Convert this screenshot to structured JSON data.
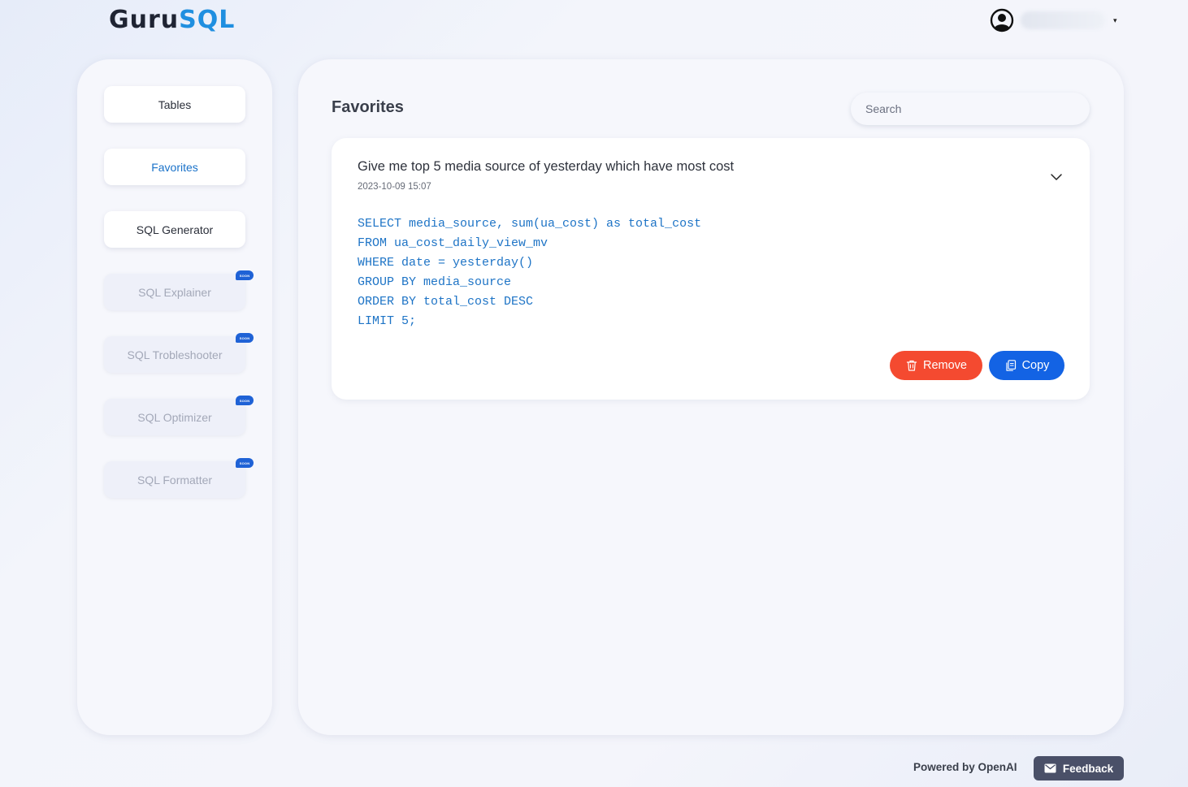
{
  "brand": {
    "logo_part1": "Guru",
    "logo_part2": "SQL"
  },
  "user": {
    "menu_caret": "▾"
  },
  "sidebar": {
    "items": [
      {
        "label": "Tables",
        "state": "normal"
      },
      {
        "label": "Favorites",
        "state": "active"
      },
      {
        "label": "SQL Generator",
        "state": "normal"
      },
      {
        "label": "SQL Explainer",
        "state": "disabled",
        "badge": "SOON"
      },
      {
        "label": "SQL Trobleshooter",
        "state": "disabled",
        "badge": "SOON"
      },
      {
        "label": "SQL Optimizer",
        "state": "disabled",
        "badge": "SOON"
      },
      {
        "label": "SQL Formatter",
        "state": "disabled",
        "badge": "SOON"
      }
    ]
  },
  "main": {
    "title": "Favorites",
    "search": {
      "placeholder": "Search",
      "value": ""
    },
    "favorite": {
      "question": "Give me top 5 media source of yesterday which have most cost",
      "timestamp": "2023-10-09 15:07",
      "sql": "SELECT media_source, sum(ua_cost) as total_cost\nFROM ua_cost_daily_view_mv\nWHERE date = yesterday()\nGROUP BY media_source\nORDER BY total_cost DESC\nLIMIT 5;",
      "remove_label": "Remove",
      "copy_label": "Copy"
    }
  },
  "footer": {
    "powered_by": "Powered by OpenAI",
    "feedback_label": "Feedback"
  },
  "colors": {
    "accent": "#1a72c9",
    "remove": "#f44a30",
    "copy": "#1363e4",
    "code": "#1e74c6",
    "feedback": "#4a5068"
  }
}
